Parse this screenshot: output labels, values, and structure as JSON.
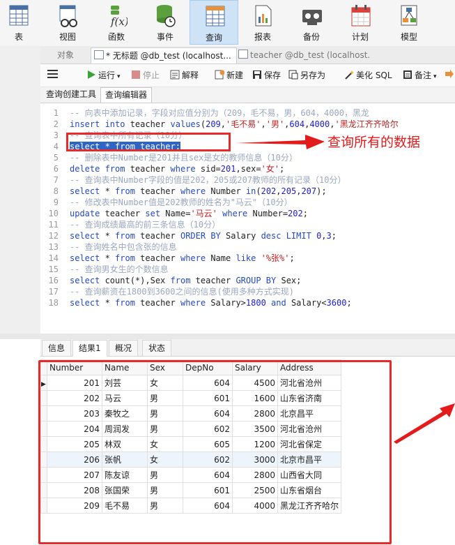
{
  "toolbar": {
    "items": [
      {
        "label": "表",
        "icon": "table-icon"
      },
      {
        "label": "视图",
        "icon": "view-icon"
      },
      {
        "label": "函数",
        "icon": "function-icon"
      },
      {
        "label": "事件",
        "icon": "event-icon"
      },
      {
        "label": "查询",
        "icon": "query-icon",
        "active": true
      },
      {
        "label": "报表",
        "icon": "report-icon"
      },
      {
        "label": "备份",
        "icon": "backup-icon"
      },
      {
        "label": "计划",
        "icon": "schedule-icon"
      },
      {
        "label": "模型",
        "icon": "model-icon"
      }
    ]
  },
  "tabs": {
    "objects": "对象",
    "tab1": "* 无标题 @db_test (localhost...",
    "tab2": "teacher @db_test (localhost..."
  },
  "actions": {
    "run": "运行",
    "stop": "停止",
    "explain": "解释",
    "new": "新建",
    "save": "保存",
    "save_as": "另存为",
    "beautify": "美化 SQL",
    "note": "备注"
  },
  "subtabs": {
    "builder": "查询创建工具",
    "editor": "查询编辑器"
  },
  "editor": {
    "lines": [
      {
        "n": "1",
        "segs": [
          {
            "t": "-- 向表中添加记录，字段对应值分别为（209，毛不易，男，604，4000，黑龙",
            "c": "cm"
          }
        ]
      },
      {
        "n": "2",
        "segs": [
          {
            "t": "insert into",
            "c": "kw"
          },
          {
            "t": " teacher ",
            "c": ""
          },
          {
            "t": "values",
            "c": "kw"
          },
          {
            "t": "(",
            "c": ""
          },
          {
            "t": "209",
            "c": "nm"
          },
          {
            "t": ",",
            "c": ""
          },
          {
            "t": "'毛不易'",
            "c": "st"
          },
          {
            "t": ",",
            "c": ""
          },
          {
            "t": "'男'",
            "c": "st"
          },
          {
            "t": ",",
            "c": ""
          },
          {
            "t": "604",
            "c": "nm"
          },
          {
            "t": ",",
            "c": ""
          },
          {
            "t": "4000",
            "c": "nm"
          },
          {
            "t": ",",
            "c": ""
          },
          {
            "t": "'黑龙江齐齐哈尔",
            "c": "st"
          }
        ]
      },
      {
        "n": "3",
        "segs": [
          {
            "t": "-- 查询表中所有记录（10分）",
            "c": "cm"
          }
        ]
      },
      {
        "n": "4",
        "segs": [
          {
            "t": "select * from teacher;",
            "c": "sel"
          }
        ]
      },
      {
        "n": "5",
        "segs": [
          {
            "t": "-- 删除表中Number是201并且sex是女的教师信息（10分）",
            "c": "cm"
          }
        ]
      },
      {
        "n": "6",
        "segs": [
          {
            "t": "delete from",
            "c": "kw"
          },
          {
            "t": " teacher ",
            "c": ""
          },
          {
            "t": "where",
            "c": "kw"
          },
          {
            "t": " sid=",
            "c": ""
          },
          {
            "t": "201",
            "c": "nm"
          },
          {
            "t": ",sex=",
            "c": ""
          },
          {
            "t": "'女'",
            "c": "st"
          },
          {
            "t": ";",
            "c": ""
          }
        ]
      },
      {
        "n": "7",
        "segs": [
          {
            "t": "-- 查询表中Number字段的值是202，205或207教师的所有记录（10分）",
            "c": "cm"
          }
        ]
      },
      {
        "n": "8",
        "segs": [
          {
            "t": "select",
            "c": "kw"
          },
          {
            "t": " * ",
            "c": ""
          },
          {
            "t": "from",
            "c": "kw"
          },
          {
            "t": " teacher ",
            "c": ""
          },
          {
            "t": "where",
            "c": "kw"
          },
          {
            "t": " Number ",
            "c": ""
          },
          {
            "t": "in",
            "c": "kw"
          },
          {
            "t": "(",
            "c": ""
          },
          {
            "t": "202",
            "c": "nm"
          },
          {
            "t": ",",
            "c": ""
          },
          {
            "t": "205",
            "c": "nm"
          },
          {
            "t": ",",
            "c": ""
          },
          {
            "t": "207",
            "c": "nm"
          },
          {
            "t": ");",
            "c": ""
          }
        ]
      },
      {
        "n": "9",
        "segs": [
          {
            "t": "-- 修改表中Number值是202教师的姓名为\"马云\"（10分）",
            "c": "cm"
          }
        ]
      },
      {
        "n": "10",
        "segs": [
          {
            "t": "update",
            "c": "kw"
          },
          {
            "t": " teacher ",
            "c": ""
          },
          {
            "t": "set",
            "c": "kw"
          },
          {
            "t": " Name=",
            "c": ""
          },
          {
            "t": "'马云'",
            "c": "st"
          },
          {
            "t": " ",
            "c": ""
          },
          {
            "t": "where",
            "c": "kw"
          },
          {
            "t": " Number=",
            "c": ""
          },
          {
            "t": "202",
            "c": "nm"
          },
          {
            "t": ";",
            "c": ""
          }
        ]
      },
      {
        "n": "11",
        "segs": [
          {
            "t": "-- 查询成绩最高的前三条信息（10分）",
            "c": "cm"
          }
        ]
      },
      {
        "n": "12",
        "segs": [
          {
            "t": "select",
            "c": "kw"
          },
          {
            "t": " * ",
            "c": ""
          },
          {
            "t": "from",
            "c": "kw"
          },
          {
            "t": " teacher ",
            "c": ""
          },
          {
            "t": "ORDER BY",
            "c": "kw"
          },
          {
            "t": " Salary ",
            "c": ""
          },
          {
            "t": "desc LIMIT",
            "c": "kw"
          },
          {
            "t": " ",
            "c": ""
          },
          {
            "t": "0",
            "c": "nm"
          },
          {
            "t": ",",
            "c": ""
          },
          {
            "t": "3",
            "c": "nm"
          },
          {
            "t": ";",
            "c": ""
          }
        ]
      },
      {
        "n": "13",
        "segs": [
          {
            "t": "-- 查询姓名中包含张的信息",
            "c": "cm"
          }
        ]
      },
      {
        "n": "14",
        "segs": [
          {
            "t": "select",
            "c": "kw"
          },
          {
            "t": " * ",
            "c": ""
          },
          {
            "t": "from",
            "c": "kw"
          },
          {
            "t": " teacher ",
            "c": ""
          },
          {
            "t": "where",
            "c": "kw"
          },
          {
            "t": " Name ",
            "c": ""
          },
          {
            "t": "like",
            "c": "kw"
          },
          {
            "t": " ",
            "c": ""
          },
          {
            "t": "'%张%'",
            "c": "st"
          },
          {
            "t": ";",
            "c": ""
          }
        ]
      },
      {
        "n": "15",
        "segs": [
          {
            "t": "-- 查询男女生的个数信息",
            "c": "cm"
          }
        ]
      },
      {
        "n": "16",
        "segs": [
          {
            "t": "select",
            "c": "kw"
          },
          {
            "t": " count(*),Sex ",
            "c": ""
          },
          {
            "t": "from",
            "c": "kw"
          },
          {
            "t": " teacher ",
            "c": ""
          },
          {
            "t": "GROUP BY",
            "c": "kw"
          },
          {
            "t": " Sex;",
            "c": ""
          }
        ]
      },
      {
        "n": "17",
        "segs": [
          {
            "t": "-- 查询薪资在1800到3600之间的信息(使用多种方式实现)",
            "c": "cm"
          }
        ]
      },
      {
        "n": "18",
        "segs": [
          {
            "t": "select",
            "c": "kw"
          },
          {
            "t": " * ",
            "c": ""
          },
          {
            "t": "from",
            "c": "kw"
          },
          {
            "t": " teacher ",
            "c": ""
          },
          {
            "t": "where",
            "c": "kw"
          },
          {
            "t": " Salary>",
            "c": ""
          },
          {
            "t": "1800",
            "c": "nm"
          },
          {
            "t": " ",
            "c": ""
          },
          {
            "t": "and",
            "c": "kw"
          },
          {
            "t": " Salary<",
            "c": ""
          },
          {
            "t": "3600",
            "c": "nm"
          },
          {
            "t": ";",
            "c": ""
          }
        ]
      }
    ]
  },
  "annotation": {
    "text": "查询所有的数据",
    "color": "#e31b1b"
  },
  "result_tabs": [
    "信息",
    "结果1",
    "概况",
    "状态"
  ],
  "result": {
    "columns": [
      "Number",
      "Name",
      "Sex",
      "DepNo",
      "Salary",
      "Address"
    ],
    "rows": [
      [
        "201",
        "刘芸",
        "女",
        "604",
        "4500",
        "河北省沧州"
      ],
      [
        "202",
        "马云",
        "男",
        "601",
        "1600",
        "山东省济南"
      ],
      [
        "203",
        "秦牧之",
        "男",
        "604",
        "2800",
        "北京昌平"
      ],
      [
        "204",
        "周润发",
        "男",
        "602",
        "3500",
        "河北省沧州"
      ],
      [
        "205",
        "林双",
        "女",
        "605",
        "1200",
        "河北省保定"
      ],
      [
        "206",
        "张帆",
        "女",
        "602",
        "3000",
        "北京市昌平"
      ],
      [
        "207",
        "陈友谅",
        "男",
        "604",
        "2800",
        "山西省大同"
      ],
      [
        "208",
        "张国荣",
        "男",
        "601",
        "2500",
        "山东省烟台"
      ],
      [
        "209",
        "毛不易",
        "男",
        "604",
        "4000",
        "黑龙江齐齐哈尔"
      ]
    ]
  }
}
